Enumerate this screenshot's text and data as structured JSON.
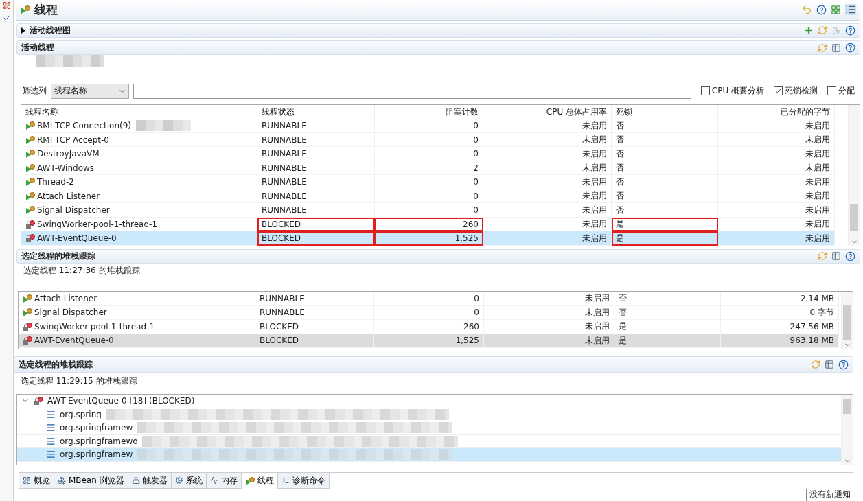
{
  "top_view": {
    "title": "线程",
    "graph_section": {
      "title": "活动线程图",
      "expanded": false
    },
    "threads_section": {
      "title": "活动线程"
    },
    "filter": {
      "label": "筛选列",
      "column": "线程名称"
    },
    "options": [
      {
        "label": "CPU 概要分析",
        "checked": false
      },
      {
        "label": "死锁检测",
        "checked": true
      },
      {
        "label": "分配",
        "checked": false
      }
    ],
    "table": {
      "columns": [
        "线程名称",
        "线程状态",
        "阻塞计数",
        "CPU 总体占用率",
        "死锁",
        "已分配的字节"
      ],
      "rows": [
        {
          "kind": "running",
          "name": "RMI TCP Connection(9)-",
          "state": "RUNNABLE",
          "blocked": "0",
          "cpu": "未启用",
          "deadlock": "否",
          "allocated": "未启用",
          "selected": false,
          "annotated": false,
          "blurred": true
        },
        {
          "kind": "running",
          "name": "RMI TCP Accept-0",
          "state": "RUNNABLE",
          "blocked": "0",
          "cpu": "未启用",
          "deadlock": "否",
          "allocated": "未启用",
          "selected": false,
          "annotated": false
        },
        {
          "kind": "running",
          "name": "DestroyJavaVM",
          "state": "RUNNABLE",
          "blocked": "0",
          "cpu": "未启用",
          "deadlock": "否",
          "allocated": "未启用",
          "selected": false,
          "annotated": false
        },
        {
          "kind": "running",
          "name": "AWT-Windows",
          "state": "RUNNABLE",
          "blocked": "2",
          "cpu": "未启用",
          "deadlock": "否",
          "allocated": "未启用",
          "selected": false,
          "annotated": false
        },
        {
          "kind": "running",
          "name": "Thread-2",
          "state": "RUNNABLE",
          "blocked": "0",
          "cpu": "未启用",
          "deadlock": "否",
          "allocated": "未启用",
          "selected": false,
          "annotated": false
        },
        {
          "kind": "running",
          "name": "Attach Listener",
          "state": "RUNNABLE",
          "blocked": "0",
          "cpu": "未启用",
          "deadlock": "否",
          "allocated": "未启用",
          "selected": false,
          "annotated": false
        },
        {
          "kind": "running",
          "name": "Signal Dispatcher",
          "state": "RUNNABLE",
          "blocked": "0",
          "cpu": "未启用",
          "deadlock": "否",
          "allocated": "未启用",
          "selected": false,
          "annotated": false
        },
        {
          "kind": "blocked",
          "name": "SwingWorker-pool-1-thread-1",
          "state": "BLOCKED",
          "blocked": "260",
          "cpu": "未启用",
          "deadlock": "是",
          "allocated": "未启用",
          "selected": false,
          "annotated": true
        },
        {
          "kind": "blocked",
          "name": "AWT-EventQueue-0",
          "state": "BLOCKED",
          "blocked": "1,525",
          "cpu": "未启用",
          "deadlock": "是",
          "allocated": "未启用",
          "selected": true,
          "annotated": true
        }
      ]
    },
    "stack_section": {
      "title": "选定线程的堆栈跟踪",
      "subtitle": "选定线程 11:27:36 的堆栈跟踪"
    }
  },
  "bottom_view": {
    "table": {
      "rows": [
        {
          "kind": "running",
          "name": "Attach Listener",
          "state": "RUNNABLE",
          "blocked": "0",
          "cpu": "未启用",
          "deadlock": "否",
          "allocated": "2.14 MB",
          "selected": false
        },
        {
          "kind": "running",
          "name": "Signal Dispatcher",
          "state": "RUNNABLE",
          "blocked": "0",
          "cpu": "未启用",
          "deadlock": "否",
          "allocated": "0 字节",
          "selected": false
        },
        {
          "kind": "blocked",
          "name": "SwingWorker-pool-1-thread-1",
          "state": "BLOCKED",
          "blocked": "260",
          "cpu": "未启用",
          "deadlock": "是",
          "allocated": "247.56 MB",
          "selected": false
        },
        {
          "kind": "blocked",
          "name": "AWT-EventQueue-0",
          "state": "BLOCKED",
          "blocked": "1,525",
          "cpu": "未启用",
          "deadlock": "是",
          "allocated": "963.18 MB",
          "selected": true
        }
      ]
    },
    "stack_section": {
      "title": "选定线程的堆栈跟踪",
      "subtitle": "选定线程 11:29:15 的堆栈跟踪",
      "tree": {
        "label": "AWT-EventQueue-0 [18] (BLOCKED)",
        "expanded": true,
        "children": [
          {
            "label": "org.spring",
            "selected": false
          },
          {
            "label": "org.springframew",
            "selected": false
          },
          {
            "label": "org.springframewo",
            "selected": false
          },
          {
            "label": "org.springframew",
            "selected": true
          }
        ]
      }
    },
    "tabs": [
      {
        "label": "概览",
        "selected": false
      },
      {
        "label": "MBean 浏览器",
        "selected": false
      },
      {
        "label": "触发器",
        "selected": false
      },
      {
        "label": "系统",
        "selected": false
      },
      {
        "label": "内存",
        "selected": false
      },
      {
        "label": "线程",
        "selected": true
      },
      {
        "label": "诊断命令",
        "selected": false
      }
    ],
    "status_bar": "没有新通知"
  }
}
